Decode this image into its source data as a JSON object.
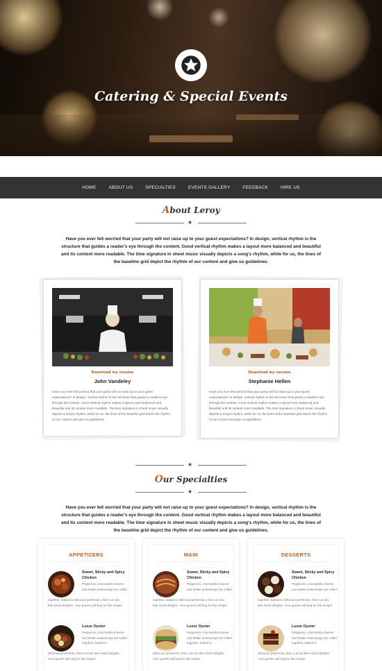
{
  "hero": {
    "title": "Catering & Special Events",
    "badge_icon": "star-icon"
  },
  "nav": {
    "items": [
      "HOME",
      "ABOUT US",
      "SPECIALTIES",
      "EVENTS GALLERY",
      "FEEDBACK",
      "HIRE US"
    ]
  },
  "about": {
    "title_first": "A",
    "title_rest": "bout Leroy",
    "intro": "Have you ever felt worried that your party will not raise up to your guest expectations? In design, vertical rhythm is the structure that guides a reader's eye through the content. Good vertical rhythm makes a layout more balanced and beautiful and its content more readable. The time signature in sheet music visually depicts a song's rhythm, while for us, the lines of the baseline grid depict the rhythm of our content and give us guidelines.",
    "profiles": [
      {
        "download": "Download my resume",
        "name": "John Vandeley",
        "bio": "Have you ever felt worried that your party will not raise up to your guest expectations? In design, vertical rhythm is the structure that guides a reader's eye through the content. Good vertical rhythm makes a layout more balanced and beautiful and its content more readable. The time signature in sheet music visually depicts a song's rhythm, while for us, the lines of the baseline grid depict the rhythm of our content and give us guidelines."
      },
      {
        "download": "Download my resume",
        "name": "Stephanie Hellen",
        "bio": "Have you ever felt worried that your party will not raise up to your guest expectations? In design, vertical rhythm is the structure that guides a reader's eye through the content. Good vertical rhythm makes a layout more balanced and beautiful and its content more readable. The time signature in sheet music visually depicts a song's rhythm, while for us, the lines of the baseline grid depict the rhythm of our content and give us guidelines."
      }
    ]
  },
  "specialties": {
    "title_first": "O",
    "title_rest": "ur Specialties",
    "intro": "Have you ever felt worried that your party will not raise up to your guest expectations? In design, vertical rhythm is the structure that guides a reader's eye through the content. Good vertical rhythm makes a layout more balanced and beautiful and its content more readable. The time signature in sheet music visually depicts a song's rhythm, while for us, the lines of the baseline grid depict the rhythm of our content and give us guidelines.",
    "menus": [
      {
        "title": "APPETIZERS",
        "items": [
          {
            "name": "Sweet, Sticky and Spicy Chicken",
            "desc": "Pepperoni, mozzarella cheese and Italian seasonings are rolled",
            "desc_cont": "together, baked to delicious perfection, then cut into bite-sized delights. Your guests will beg for the recipe!"
          },
          {
            "name": "Luxur Oyster",
            "desc": "Pepperoni, mozzarella cheese and Italian seasonings are rolled together, baked to",
            "desc_cont": "delicious perfection, then cut into bite-sized delights. Your guests will beg for the recipe!"
          }
        ]
      },
      {
        "title": "MAIN",
        "items": [
          {
            "name": "Sweet, Sticky and Spicy Chicken",
            "desc": "Pepperoni, mozzarella cheese and Italian seasonings are rolled",
            "desc_cont": "together, baked to delicious perfection, then cut into bite-sized delights. Your guests will beg for the recipe!"
          },
          {
            "name": "Luxur Oyster",
            "desc": "Pepperoni, mozzarella cheese and Italian seasonings are rolled together, baked to",
            "desc_cont": "delicious perfection, then cut into bite-sized delights. Your guests will beg for the recipe!"
          }
        ]
      },
      {
        "title": "DESSERTS",
        "items": [
          {
            "name": "Sweet, Sticky and Spicy Chicken",
            "desc": "Pepperoni, mozzarella cheese and Italian seasonings are rolled",
            "desc_cont": "together, baked to delicious perfection, then cut into bite-sized delights. Your guests will beg for the recipe!"
          },
          {
            "name": "Luxur Oyster",
            "desc": "Pepperoni, mozzarella cheese and Italian seasonings are rolled together, baked to",
            "desc_cont": "delicious perfection, then cut into bite-sized delights. Your guests will beg for the recipe!"
          }
        ]
      }
    ]
  },
  "colors": {
    "accent": "#b8612a",
    "nav_bg": "#333333"
  }
}
